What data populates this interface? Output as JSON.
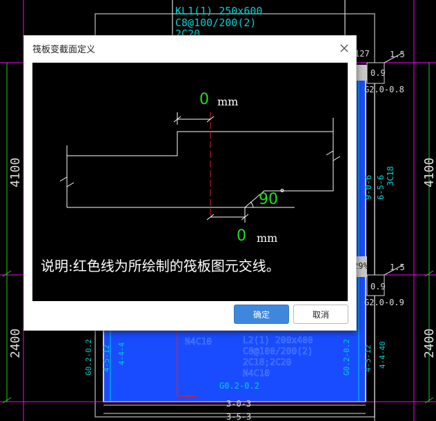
{
  "background": {
    "beam_label": "KL1(1) 250x600",
    "beam_stirrup": "C8@100/200(2)",
    "beam_partial": "2C20",
    "label_127": "127",
    "label_15_top": "1.5",
    "label_09_top": "0.9",
    "label_g20_08": "G2.0-0.8",
    "dim_4100_left": "4100",
    "dim_4100_right": "4100",
    "label_906": "9-0-6",
    "label_656": "6-5-6",
    "label_3c18": "3C18",
    "label_29pct": "29%",
    "label_15_bottom": "1.5",
    "label_09_bottom": "0.9",
    "label_g20_09": "G2.0-0.9",
    "dim_2400_left": "2400",
    "dim_2400_right": "2400",
    "label_g02_02_left": "G0.2-0.2",
    "label_4512_left": "4-5-12",
    "label_444_left": "4-4-4",
    "label_n4c10": "N4C10",
    "label_lk2": "L2(1) 200x400",
    "label_c8_200": "C8@100/200(2)",
    "label_2c18": "2C18;2C20",
    "label_n4c10b": "N4C10",
    "label_g02_02_right": "G0.2-0.2",
    "label_4512_right": "4-5-12",
    "label_4440_right": "4-4-40",
    "label_g02_02_bottom": "G0.2-0.2",
    "label_303": "3-0-3",
    "label_353": "3-5-3"
  },
  "dialog": {
    "title": "筏板变截面定义",
    "close_icon": "close-icon",
    "preview": {
      "top_offset_value": "0",
      "top_offset_unit": "mm",
      "angle_value": "90",
      "angle_unit": "°",
      "bottom_offset_value": "0",
      "bottom_offset_unit": "mm",
      "note": "说明:红色线为所绘制的筏板图元交线。"
    },
    "ok_label": "确定",
    "cancel_label": "取消"
  },
  "colors": {
    "cad_background": "#000000",
    "slab_fill": "#1a4cff",
    "input_green": "#22dd22",
    "break_line_red": "#e02020",
    "cyan_text": "#00d0d0",
    "ok_button": "#3f87dd"
  }
}
